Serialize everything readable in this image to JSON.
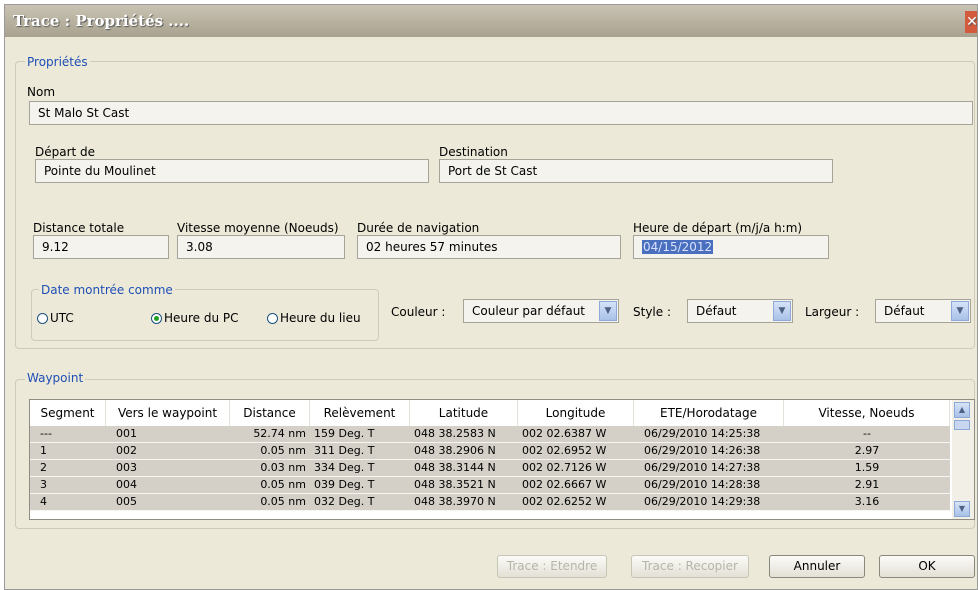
{
  "window": {
    "title": "Trace : Propriétés ....",
    "close_glyph": "✕"
  },
  "proprietes": {
    "legend": "Propriétés",
    "nom_label": "Nom",
    "nom_value": "St Malo St Cast",
    "depart_label": "Départ de",
    "depart_value": "Pointe du Moulinet",
    "destination_label": "Destination",
    "destination_value": "Port de St Cast",
    "distance_label": "Distance totale",
    "distance_value": "9.12",
    "vitesse_label": "Vitesse moyenne (Noeuds)",
    "vitesse_value": "3.08",
    "duree_label": "Durée de navigation",
    "duree_value": "02 heures  57 minutes",
    "heure_label": "Heure de départ (m/j/a h:m)",
    "heure_value": "04/15/2012"
  },
  "date_group": {
    "legend": "Date montrée comme",
    "options": [
      {
        "label": "UTC",
        "selected": false
      },
      {
        "label": "Heure du PC",
        "selected": true
      },
      {
        "label": "Heure du lieu",
        "selected": false
      }
    ]
  },
  "couleur": {
    "label": "Couleur :",
    "value": "Couleur par défaut"
  },
  "style": {
    "label": "Style :",
    "value": "Défaut"
  },
  "largeur": {
    "label": "Largeur :",
    "value": "Défaut"
  },
  "waypoint": {
    "legend": "Waypoint",
    "columns": [
      "Segment",
      "Vers le waypoint",
      "Distance",
      "Relèvement",
      "Latitude",
      "Longitude",
      "ETE/Horodatage",
      "Vitesse, Noeuds"
    ],
    "rows": [
      [
        "---",
        "001",
        "52.74 nm",
        "159 Deg. T",
        "048 38.2583 N",
        "002 02.6387 W",
        "06/29/2010 14:25:38",
        "--"
      ],
      [
        "1",
        "002",
        "0.05 nm",
        "311 Deg. T",
        "048 38.2906 N",
        "002 02.6952 W",
        "06/29/2010 14:26:38",
        "2.97"
      ],
      [
        "2",
        "003",
        "0.03 nm",
        "334 Deg. T",
        "048 38.3144 N",
        "002 02.7126 W",
        "06/29/2010 14:27:38",
        "1.59"
      ],
      [
        "3",
        "004",
        "0.05 nm",
        "039 Deg. T",
        "048 38.3521 N",
        "002 02.6667 W",
        "06/29/2010 14:28:38",
        "2.91"
      ],
      [
        "4",
        "005",
        "0.05 nm",
        "032 Deg. T",
        "048 38.3970 N",
        "002 02.6252 W",
        "06/29/2010 14:29:38",
        "3.16"
      ]
    ]
  },
  "buttons": {
    "etendre": "Trace : Etendre",
    "recopier": "Trace : Recopier",
    "annuler": "Annuler",
    "ok": "OK"
  },
  "icons": {
    "combo_arrow": "chevron-down-icon",
    "scroll_up": "chevron-up-icon",
    "scroll_down": "chevron-down-icon"
  }
}
